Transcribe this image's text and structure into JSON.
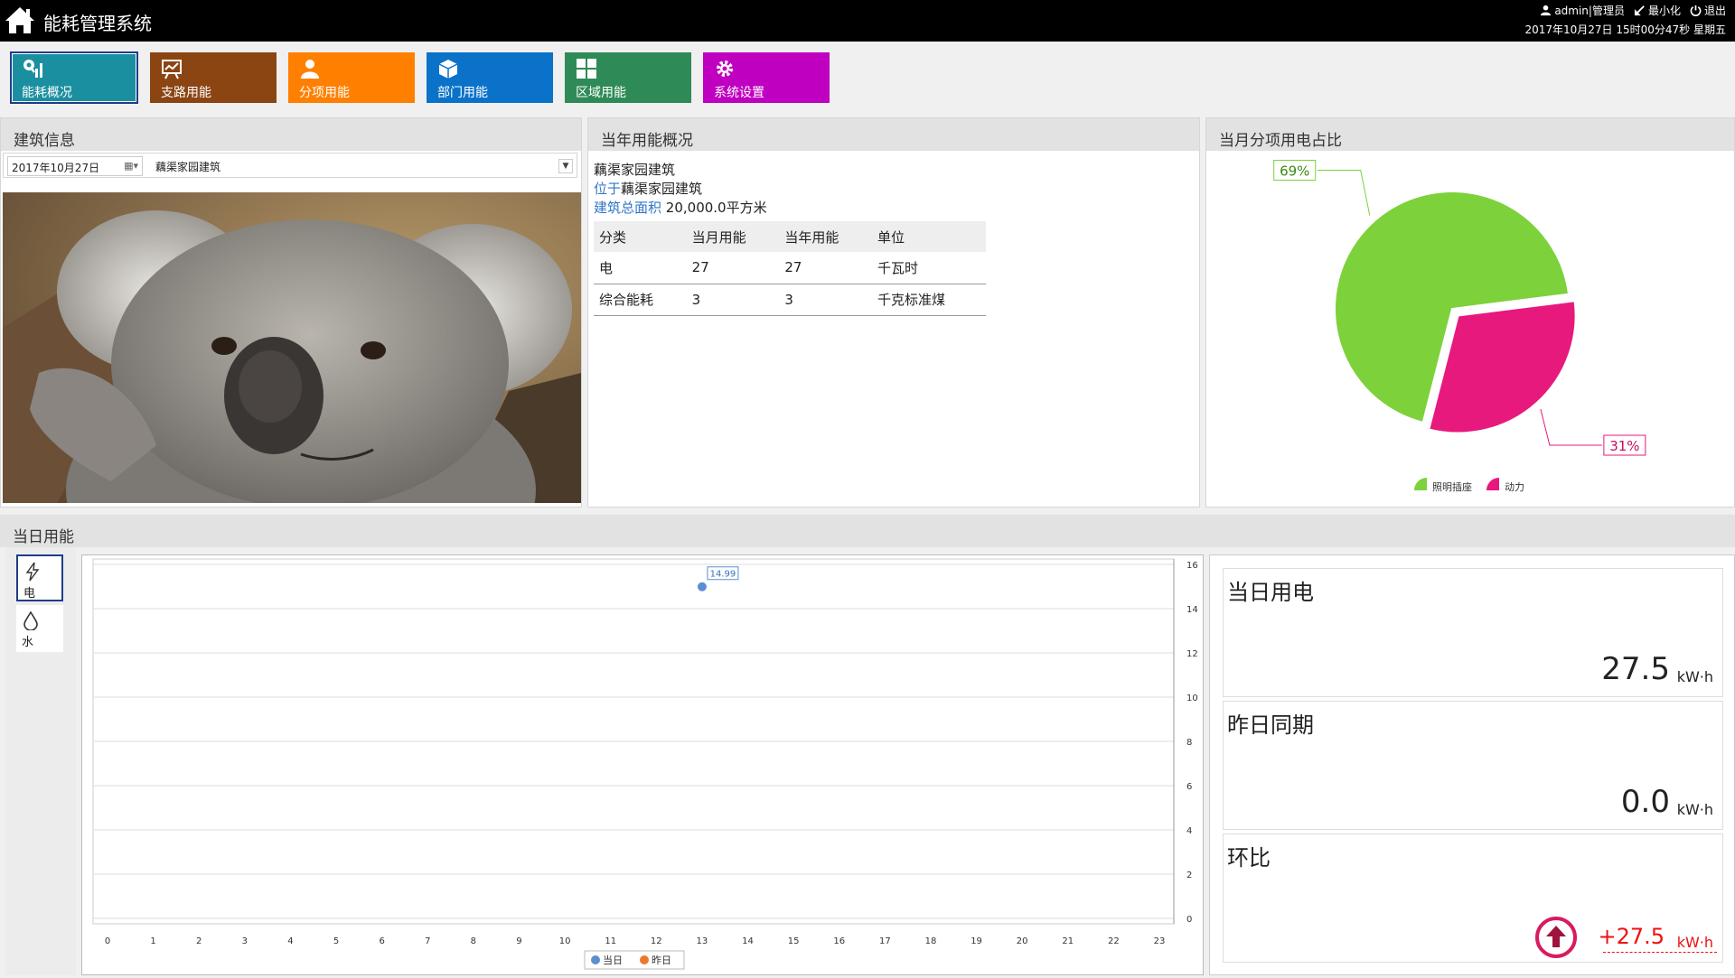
{
  "header": {
    "title": "能耗管理系统",
    "user": "admin|管理员",
    "minimize": "最小化",
    "logout": "退出",
    "datetime": "2017年10月27日 15时00分47秒 星期五"
  },
  "nav": [
    {
      "label": "能耗概况",
      "color": "#1a8fa0",
      "icon": "overview-icon"
    },
    {
      "label": "支路用能",
      "color": "#8b4513",
      "icon": "branch-chart-icon"
    },
    {
      "label": "分项用能",
      "color": "#ff8000",
      "icon": "user-icon"
    },
    {
      "label": "部门用能",
      "color": "#0b72c9",
      "icon": "cube-icon"
    },
    {
      "label": "区域用能",
      "color": "#2e8b57",
      "icon": "grid-icon"
    },
    {
      "label": "系统设置",
      "color": "#c000c0",
      "icon": "gear-icon"
    }
  ],
  "building": {
    "title": "建筑信息",
    "date": "2017年10月27日",
    "selected": "藕渠家园建筑"
  },
  "annual": {
    "title": "当年用能概况",
    "name": "藕渠家园建筑",
    "location_label": "位于",
    "location": "藕渠家园建筑",
    "area_label": "建筑总面积",
    "area": "20,000.0平方米",
    "headers": [
      "分类",
      "当月用能",
      "当年用能",
      "单位"
    ],
    "rows": [
      [
        "电",
        "27",
        "27",
        "千瓦时"
      ],
      [
        "综合能耗",
        "3",
        "3",
        "千克标准煤"
      ]
    ]
  },
  "pie_panel": {
    "title": "当月分项用电占比"
  },
  "daily": {
    "title": "当日用能",
    "tabs": [
      {
        "label": "电",
        "icon": "lightning-icon"
      },
      {
        "label": "水",
        "icon": "water-drop-icon"
      }
    ],
    "stats": [
      {
        "title": "当日用电",
        "value": "27.5",
        "unit": "kW·h"
      },
      {
        "title": "昨日同期",
        "value": "0.0",
        "unit": "kW·h"
      },
      {
        "title": "环比",
        "value": "+27.5",
        "unit": "kW·h",
        "icon": "up-arrow-icon"
      }
    ]
  },
  "chart_data": [
    {
      "type": "pie",
      "categories": [
        "照明插座",
        "动力"
      ],
      "values": [
        69,
        31
      ],
      "labels": [
        "69%",
        "31%"
      ],
      "colors": [
        "#7dd13a",
        "#e8197c"
      ],
      "legend": "bottom"
    },
    {
      "type": "line",
      "x": [
        0,
        1,
        2,
        3,
        4,
        5,
        6,
        7,
        8,
        9,
        10,
        11,
        12,
        13,
        14,
        15,
        16,
        17,
        18,
        19,
        20,
        21,
        22,
        23
      ],
      "series": [
        {
          "name": "当日",
          "points": [
            [
              13,
              14.99
            ]
          ],
          "color": "#5b8fd1"
        },
        {
          "name": "昨日",
          "points": [],
          "color": "#e87a2a"
        }
      ],
      "point_labels": [
        "14.99"
      ],
      "ylim": [
        0,
        16
      ],
      "yticks": [
        0,
        2,
        4,
        6,
        8,
        10,
        12,
        14,
        16
      ],
      "y_axis_side": "right",
      "legend": "bottom",
      "grid": true
    }
  ]
}
